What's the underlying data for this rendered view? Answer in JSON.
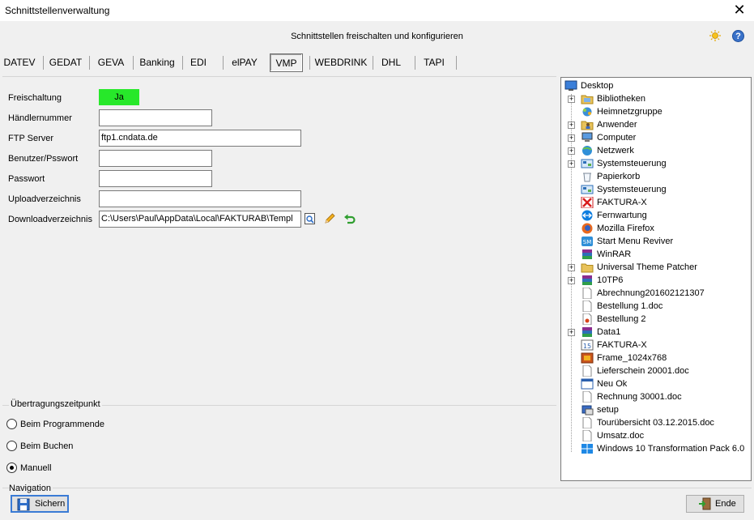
{
  "window": {
    "title": "Schnittstellenverwaltung"
  },
  "header": {
    "caption": "Schnittstellen freischalten und konfigurieren"
  },
  "tabs": [
    "DATEV",
    "GEDAT",
    "GEVA",
    "Banking",
    "EDI",
    "elPAY",
    "VMP",
    "WEBDRINK",
    "DHL",
    "TAPI"
  ],
  "active_tab": "VMP",
  "form": {
    "freischaltung_label": "Freischaltung",
    "freischaltung_value": "Ja",
    "haendlernummer_label": "Händlernummer",
    "haendlernummer_value": "",
    "ftp_server_label": "FTP Server",
    "ftp_server_value": "ftp1.cndata.de",
    "benutzer_label": "Benutzer/Psswort",
    "benutzer_value": "",
    "passwort_label": "Passwort",
    "passwort_value": "",
    "upload_label": "Uploadverzeichnis",
    "upload_value": "",
    "download_label": "Downloadverzeichnis",
    "download_value": "C:\\Users\\Paul\\AppData\\Local\\FAKTURAB\\Templ"
  },
  "uebertragung": {
    "title": "Übertragungszeitpunkt",
    "options": [
      "Beim Programmende",
      "Beim Buchen",
      "Manuell"
    ],
    "selected": "Manuell"
  },
  "navigation": {
    "title": "Navigation",
    "save_label": "Sichern",
    "end_label": "Ende"
  },
  "tree": {
    "root": "Desktop",
    "items": [
      "Bibliotheken",
      "Heimnetzgruppe",
      "Anwender",
      "Computer",
      "Netzwerk",
      "Systemsteuerung",
      "Papierkorb",
      "Systemsteuerung",
      "FAKTURA-X",
      "Fernwartung",
      "Mozilla Firefox",
      "Start Menu Reviver",
      "WinRAR",
      "Universal Theme Patcher",
      "10TP6",
      "Abrechnung201602121307",
      "Bestellung 1.doc",
      "Bestellung 2",
      "Data1",
      "FAKTURA-X",
      "Frame_1024x768",
      "Lieferschein 20001.doc",
      "Neu Ok",
      "Rechnung 30001.doc",
      "setup",
      "Tourübersicht 03.12.2015.doc",
      "Umsatz.doc",
      "Windows 10 Transformation Pack 6.0"
    ]
  }
}
